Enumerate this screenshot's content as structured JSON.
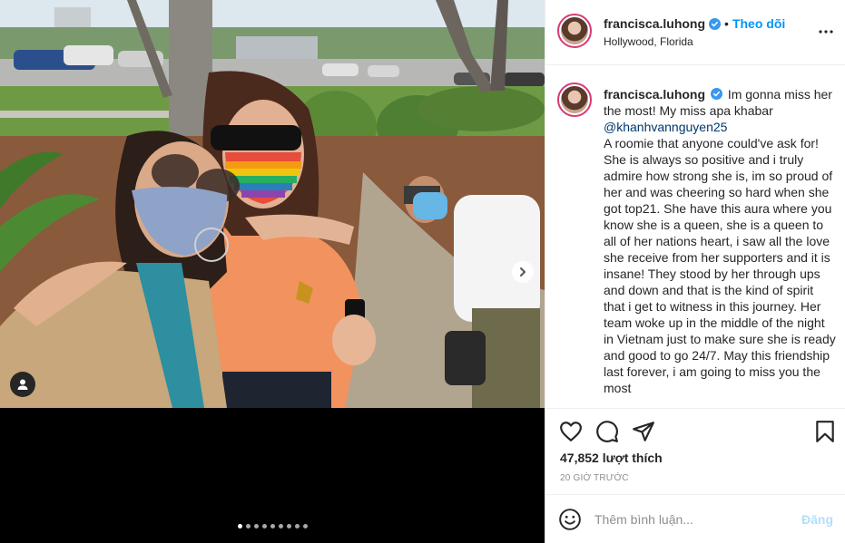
{
  "post": {
    "username": "francisca.luhong",
    "follow_label": "Theo dõi",
    "bullet": "•",
    "location": "Hollywood, Florida",
    "caption_text": "Im gonna miss her the most! My miss apa khabar",
    "caption_mention": "@khanhvannguyen25",
    "caption_body": "A roomie that anyone could've ask for! She is always so positive and i truly admire how strong she is, im so proud of her and was cheering so hard when she got top21. She have this aura where you know she is a queen, she is a queen to all of her nations heart, i saw all the love she receive from her supporters and it is insane! They stood by her through ups and down and that is the kind of spirit that i get to witness in this journey. Her team woke up in the middle of the night in Vietnam just to make sure she is ready and good to go 24/7. May this friendship last forever, i am going to miss you the most",
    "likes": "47,852 lượt thích",
    "time_ago": "20 GIỜ TRƯỚC"
  },
  "comment_box": {
    "placeholder": "Thêm bình luận...",
    "post_label": "Đăng"
  },
  "carousel": {
    "total": 9,
    "active_index": 0
  },
  "icons": {
    "verified": "verified-badge-icon",
    "more": "more-options-icon",
    "like": "heart-icon",
    "comment": "comment-bubble-icon",
    "share": "paper-plane-icon",
    "save": "bookmark-icon",
    "emoji": "emoji-smiley-icon",
    "next": "chevron-right-icon",
    "tag": "user-tag-icon"
  },
  "colors": {
    "follow": "#0095f6",
    "verified": "#3897f0",
    "post_disabled": "#b2dffc",
    "muted": "#8e8e8e",
    "border": "#efefef"
  }
}
